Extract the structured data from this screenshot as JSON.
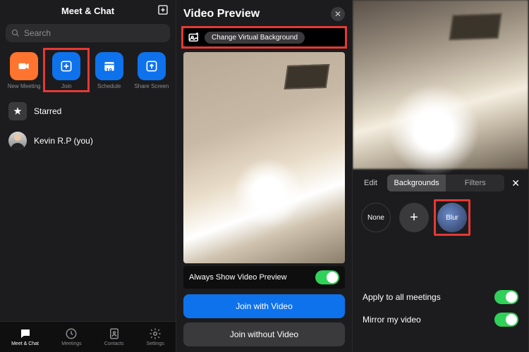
{
  "panel1": {
    "title": "Meet & Chat",
    "search_placeholder": "Search",
    "actions": {
      "new_meeting": "New Meeting",
      "join": "Join",
      "schedule": "Schedule",
      "schedule_day": "19",
      "share_screen": "Share Screen"
    },
    "starred_label": "Starred",
    "self_contact": "Kevin R.P (you)",
    "tabs": {
      "meet_chat": "Meet & Chat",
      "meetings": "Meetings",
      "contacts": "Contacts",
      "settings": "Settings"
    }
  },
  "panel2": {
    "title": "Video Preview",
    "change_vbg": "Change Virtual Background",
    "always_show": "Always Show Video Preview",
    "join_with_video": "Join with Video",
    "join_without_video": "Join without Video"
  },
  "panel3": {
    "edit": "Edit",
    "seg_backgrounds": "Backgrounds",
    "seg_filters": "Filters",
    "opt_none": "None",
    "opt_blur": "Blur",
    "apply_all": "Apply to all meetings",
    "mirror": "Mirror my video"
  }
}
